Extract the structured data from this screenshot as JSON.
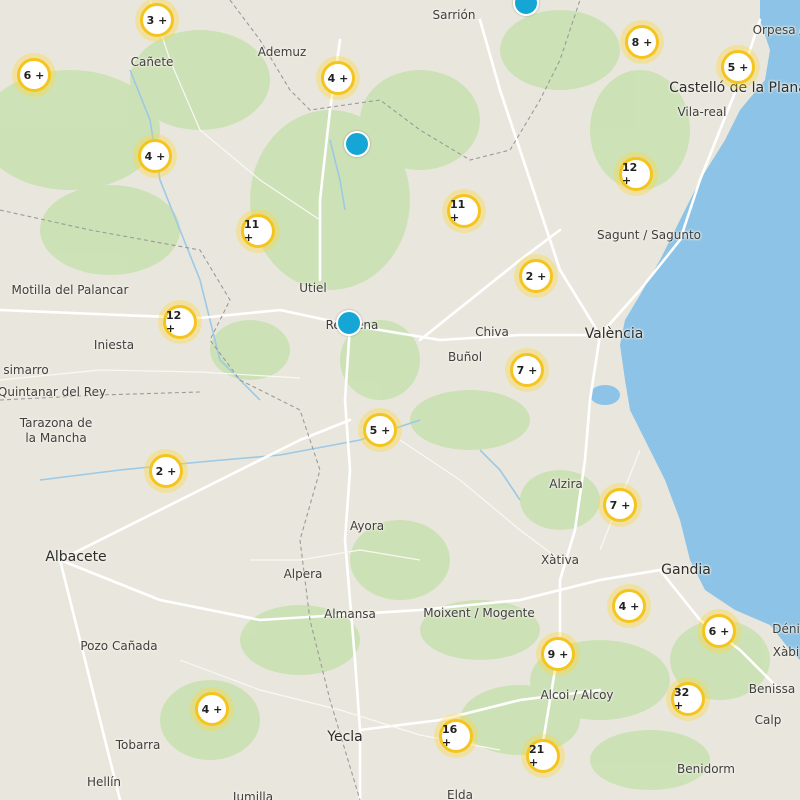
{
  "colors": {
    "land": "#e9e7dd",
    "sea": "#8cc3e6",
    "forest": "#c7dfb0",
    "road": "#ffffff",
    "border": "#9a9a9a",
    "cluster_ring": "#f5c51e",
    "cluster_halo": "#ffd633",
    "pin": "#16a6d6"
  },
  "places": [
    {
      "label": "Sarrión"
    },
    {
      "label": "Orpesa /"
    },
    {
      "label": "Ademuz"
    },
    {
      "label": "Cañete"
    },
    {
      "label": "Castelló de la Plana"
    },
    {
      "label": "Vila-real"
    },
    {
      "label": "Sagunt / Sagunto"
    },
    {
      "label": "Utiel"
    },
    {
      "label": "Motilla del Palancar"
    },
    {
      "label": "Requena"
    },
    {
      "label": "Chiva"
    },
    {
      "label": "València"
    },
    {
      "label": "Buñol"
    },
    {
      "label": "Iniesta"
    },
    {
      "label": "simarro"
    },
    {
      "label": "Quintanar del Rey"
    },
    {
      "label": "Tarazona de"
    },
    {
      "label": "la Mancha"
    },
    {
      "label": "Alzira"
    },
    {
      "label": "Ayora"
    },
    {
      "label": "Xàtiva"
    },
    {
      "label": "Albacete"
    },
    {
      "label": "Alpera"
    },
    {
      "label": "Gandia"
    },
    {
      "label": "Almansa"
    },
    {
      "label": "Moixent / Mogente"
    },
    {
      "label": "Déni"
    },
    {
      "label": "Pozo Cañada"
    },
    {
      "label": "Xàbi"
    },
    {
      "label": "Alcoi / Alcoy"
    },
    {
      "label": "Benissa"
    },
    {
      "label": "Calp"
    },
    {
      "label": "Yecla"
    },
    {
      "label": "Tobarra"
    },
    {
      "label": "Hellín"
    },
    {
      "label": "Jumilla"
    },
    {
      "label": "Elda"
    },
    {
      "label": "Benidorm"
    }
  ],
  "clusters": [
    {
      "label": "3 +"
    },
    {
      "label": "6 +"
    },
    {
      "label": "4 +"
    },
    {
      "label": "8 +"
    },
    {
      "label": "5 +"
    },
    {
      "label": "4 +"
    },
    {
      "label": "12 +"
    },
    {
      "label": "11 +"
    },
    {
      "label": "11 +"
    },
    {
      "label": "2 +"
    },
    {
      "label": "12 +"
    },
    {
      "label": "7 +"
    },
    {
      "label": "5 +"
    },
    {
      "label": "2 +"
    },
    {
      "label": "7 +"
    },
    {
      "label": "4 +"
    },
    {
      "label": "6 +"
    },
    {
      "label": "9 +"
    },
    {
      "label": "32 +"
    },
    {
      "label": "4 +"
    },
    {
      "label": "16 +"
    },
    {
      "label": "21 +"
    }
  ],
  "pins_count": 3
}
